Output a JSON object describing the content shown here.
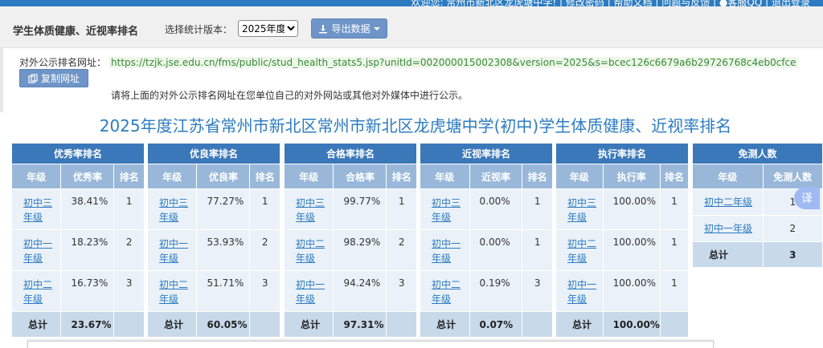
{
  "topbar": {
    "welcome": "欢迎您: 常州市新北区龙虎塘中学!",
    "links": [
      "修改密码",
      "帮助文档",
      "问题与反馈",
      "客服QQ",
      "退出登录"
    ]
  },
  "toolbar": {
    "title": "学生体质健康、近视率排名",
    "version_label": "选择统计版本：",
    "version_selected": "2025年度",
    "export_label": "导出数据"
  },
  "url_row": {
    "label": "对外公示排名网址：",
    "url": "https://tzjk.jse.edu.cn/fms/public/stud_health_stats5.jsp?unitId=002000015002308&version=2025&s=bcec126c6679a6b29726768c4eb0cfce",
    "copy_label": "复制网址",
    "notice": "请将上面的对外公示排名网址在您单位自己的对外网站或其他对外媒体中进行公示。"
  },
  "page_title": "2025年度江苏省常州市新北区常州市新北区龙虎塘中学(初中)学生体质健康、近视率排名",
  "tables": [
    {
      "title": "优秀率排名",
      "headers": [
        "年级",
        "优秀率",
        "排名"
      ],
      "rows": [
        [
          "初中三年级",
          "38.41%",
          "1"
        ],
        [
          "初中一年级",
          "18.23%",
          "2"
        ],
        [
          "初中二年级",
          "16.73%",
          "3"
        ]
      ],
      "total": [
        "总计",
        "23.67%",
        ""
      ]
    },
    {
      "title": "优良率排名",
      "headers": [
        "年级",
        "优良率",
        "排名"
      ],
      "rows": [
        [
          "初中三年级",
          "77.27%",
          "1"
        ],
        [
          "初中一年级",
          "53.93%",
          "2"
        ],
        [
          "初中二年级",
          "51.71%",
          "3"
        ]
      ],
      "total": [
        "总计",
        "60.05%",
        ""
      ]
    },
    {
      "title": "合格率排名",
      "headers": [
        "年级",
        "合格率",
        "排名"
      ],
      "rows": [
        [
          "初中三年级",
          "99.77%",
          "1"
        ],
        [
          "初中二年级",
          "98.29%",
          "2"
        ],
        [
          "初中一年级",
          "94.24%",
          "3"
        ]
      ],
      "total": [
        "总计",
        "97.31%",
        ""
      ]
    },
    {
      "title": "近视率排名",
      "headers": [
        "年级",
        "近视率",
        "排名"
      ],
      "rows": [
        [
          "初中三年级",
          "0.00%",
          "1"
        ],
        [
          "初中一年级",
          "0.00%",
          "1"
        ],
        [
          "初中二年级",
          "0.19%",
          "3"
        ]
      ],
      "total": [
        "总计",
        "0.07%",
        ""
      ]
    },
    {
      "title": "执行率排名",
      "headers": [
        "年级",
        "执行率",
        "排名"
      ],
      "rows": [
        [
          "初中三年级",
          "100.00%",
          "1"
        ],
        [
          "初中二年级",
          "100.00%",
          "1"
        ],
        [
          "初中一年级",
          "100.00%",
          "1"
        ]
      ],
      "total": [
        "总计",
        "100.00%",
        ""
      ]
    }
  ],
  "exempt_table": {
    "title": "免测人数",
    "headers": [
      "年级",
      "免测人数"
    ],
    "rows": [
      [
        "初中二年级",
        "1"
      ],
      [
        "初中一年级",
        "2"
      ]
    ],
    "total": [
      "总计",
      "3"
    ]
  },
  "translate_label": "译",
  "icons": {
    "export": "download-icon",
    "copy": "copy-icon",
    "qq": "qq-icon"
  },
  "colors": {
    "header": "#3a78b9",
    "subheader": "#99b8d9",
    "cell": "#eaf1f8",
    "total": "#c8d9ea",
    "title": "#2c7bc0",
    "url": "#3a8a3a"
  }
}
